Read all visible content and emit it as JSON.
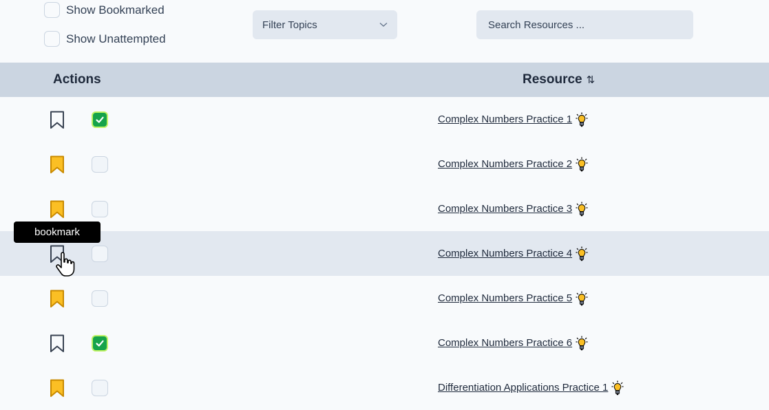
{
  "filters": {
    "show_bookmarked": "Show Bookmarked",
    "show_unattempted": "Show Unattempted",
    "topics_label": "Filter Topics",
    "search_placeholder": "Search Resources ..."
  },
  "table": {
    "col_actions": "Actions",
    "col_resource": "Resource",
    "sort_icon": "⇅"
  },
  "rows": [
    {
      "title": "Complex Numbers Practice 1",
      "bookmarked": false,
      "attempted": true
    },
    {
      "title": "Complex Numbers Practice 2",
      "bookmarked": true,
      "attempted": false
    },
    {
      "title": "Complex Numbers Practice 3",
      "bookmarked": true,
      "attempted": false
    },
    {
      "title": "Complex Numbers Practice 4",
      "bookmarked": false,
      "attempted": false
    },
    {
      "title": "Complex Numbers Practice 5",
      "bookmarked": true,
      "attempted": false
    },
    {
      "title": "Complex Numbers Practice 6",
      "bookmarked": false,
      "attempted": true
    },
    {
      "title": "Differentiation Applications Practice 1",
      "bookmarked": true,
      "attempted": false
    }
  ],
  "tooltip": "bookmark",
  "colors": {
    "bookmark_fill": "#fbbf24",
    "check_green": "#16a34a",
    "header_bg": "#cbd5e1"
  },
  "icons": {
    "bookmark": "bookmark-icon",
    "hint": "lightbulb-icon",
    "cursor": "hand-pointer-icon"
  }
}
